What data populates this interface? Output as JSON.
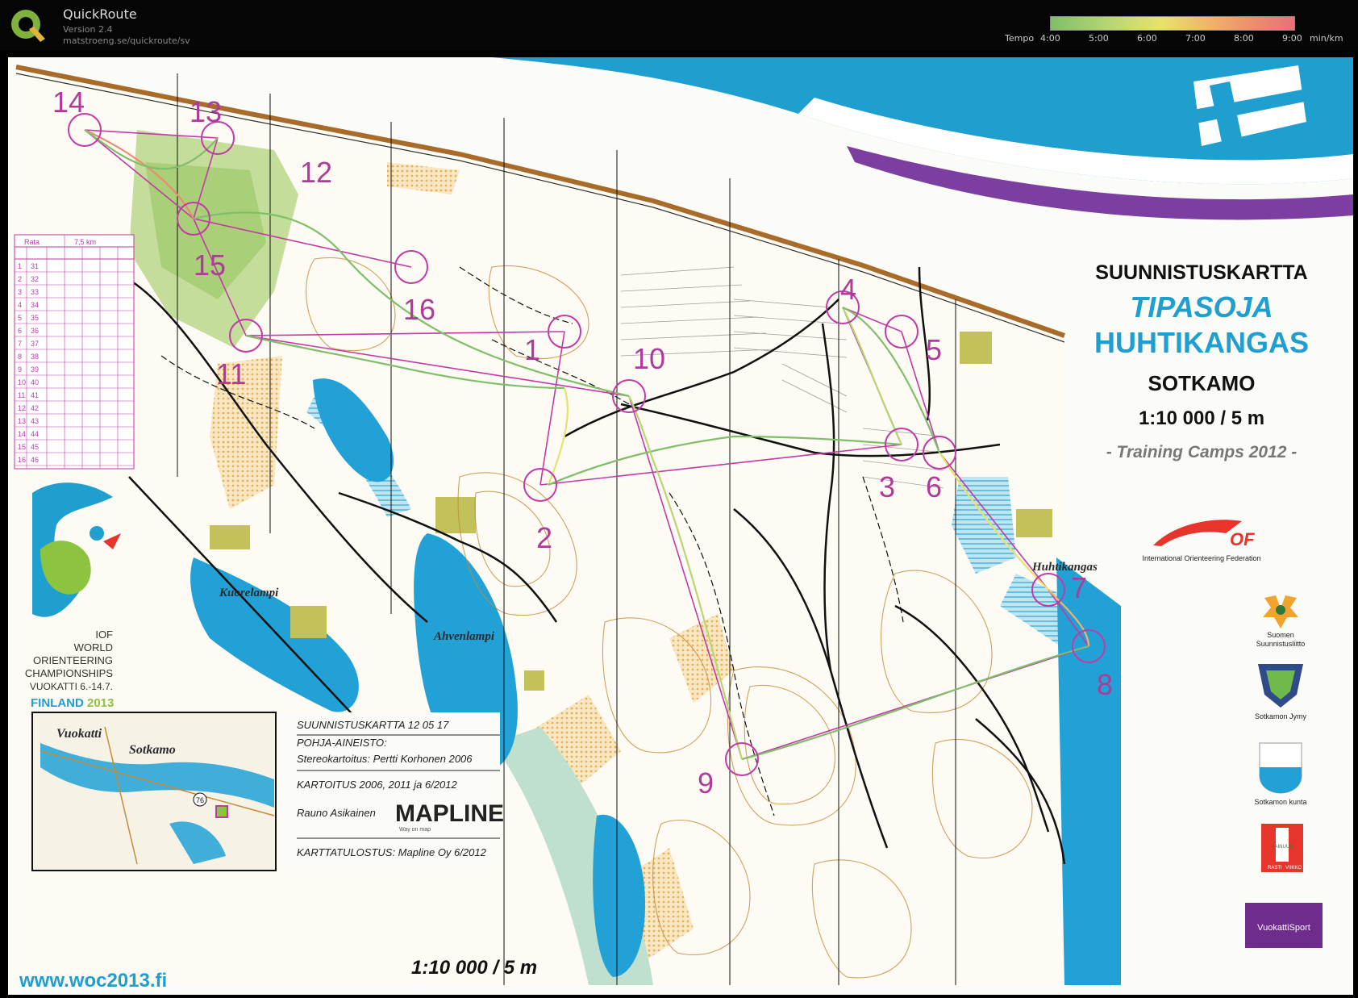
{
  "app": {
    "title": "QuickRoute",
    "version": "Version 2.4",
    "url": "matstroeng.se/quickroute/sv"
  },
  "tempo": {
    "label": "Tempo",
    "ticks": [
      "4:00",
      "5:00",
      "6:00",
      "7:00",
      "8:00",
      "9:00"
    ],
    "unit": "min/km",
    "colors": [
      "#7fbf6a",
      "#e6e36d",
      "#ec8a6d"
    ]
  },
  "map": {
    "heading": "SUUNNISTUSKARTTA",
    "name_line1": "TIPASOJA",
    "name_line2": "HUHTIKANGAS",
    "place": "SOTKAMO",
    "scale": "1:10 000 / 5 m",
    "subtitle": "- Training Camps 2012 -",
    "website": "www.woc2013.fi",
    "bottom_scale": "1:10 000 / 5 m",
    "lakes": [
      "Kuorelampi",
      "Ahvenlampi"
    ],
    "village": "Huhtikangas",
    "inset_labels": [
      "Vuokatti",
      "Sotkamo"
    ],
    "inset_road": "76"
  },
  "course": {
    "header_left": "Rata",
    "header_right": "7,5 km",
    "controls": [
      {
        "n": "1",
        "code": "31"
      },
      {
        "n": "2",
        "code": "32"
      },
      {
        "n": "3",
        "code": "33"
      },
      {
        "n": "4",
        "code": "34"
      },
      {
        "n": "5",
        "code": "35"
      },
      {
        "n": "6",
        "code": "36"
      },
      {
        "n": "7",
        "code": "37"
      },
      {
        "n": "8",
        "code": "38"
      },
      {
        "n": "9",
        "code": "39"
      },
      {
        "n": "10",
        "code": "40"
      },
      {
        "n": "11",
        "code": "41"
      },
      {
        "n": "12",
        "code": "42"
      },
      {
        "n": "13",
        "code": "43"
      },
      {
        "n": "14",
        "code": "44"
      },
      {
        "n": "15",
        "code": "45"
      },
      {
        "n": "16",
        "code": "46"
      }
    ],
    "control_numbers": [
      "1",
      "2",
      "3",
      "4",
      "5",
      "6",
      "7",
      "8",
      "9",
      "10",
      "11",
      "12",
      "13",
      "14",
      "15",
      "16"
    ]
  },
  "woc": {
    "line1": "IOF",
    "line2": "WORLD",
    "line3": "ORIENTEERING",
    "line4": "CHAMPIONSHIPS",
    "line5": "VUOKATTI 6.-14.7.",
    "line6_a": "FINLAND",
    "line6_b": "2013"
  },
  "imprint": {
    "l1": "SUUNNISTUSKARTTA 12 05 17",
    "l2": "POHJA-AINEISTO:",
    "l3": "Stereokartoitus: Pertti Korhonen 2006",
    "l4": "KARTOITUS 2006, 2011 ja 6/2012",
    "l5": "Rauno Asikainen",
    "l6": "KARTTATULOSTUS: Mapline Oy 6/2012",
    "mapline": "MAPLINE",
    "mapline_tag": "Way on map"
  },
  "sponsors": {
    "iof": "OF",
    "iof_caption": "International Orienteering Federation",
    "ssl_caption_1": "Suomen",
    "ssl_caption_2": "Suunnistusliitto",
    "jymy_caption": "Sotkamon Jymy",
    "kunta_caption": "Sotkamon kunta",
    "rasti_top": "KAINUUN",
    "rasti_l": "RASTI",
    "rasti_r": "VIIKKO",
    "vuokatti": "VuokattiSport"
  }
}
